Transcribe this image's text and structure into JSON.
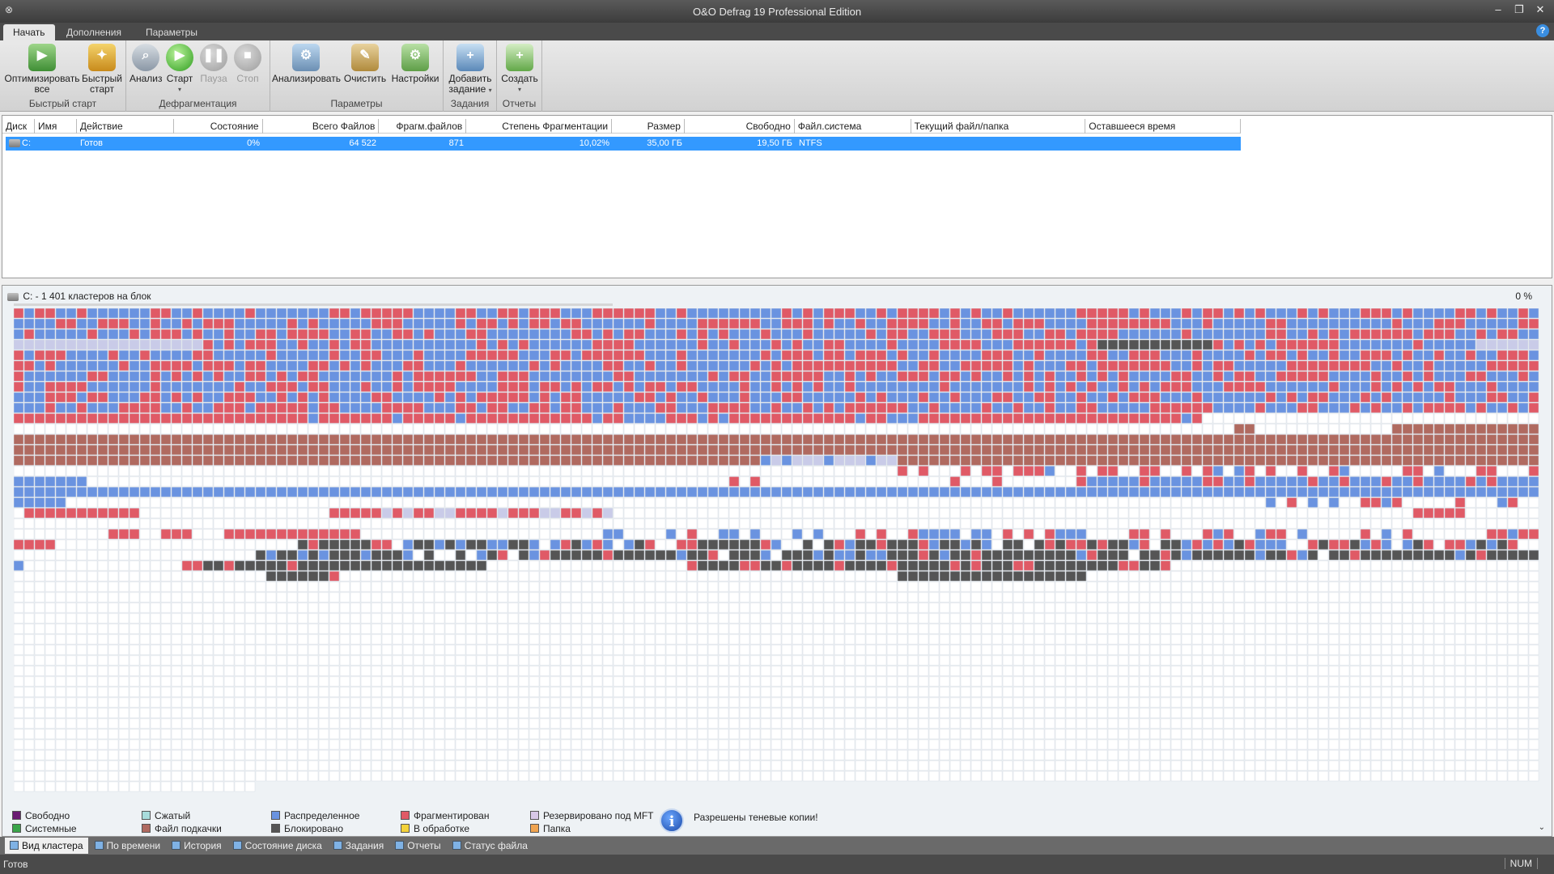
{
  "window": {
    "title": "O&O Defrag 19 Professional Edition",
    "minimize": "–",
    "restore": "❐",
    "close": "✕",
    "sysmenu": "⊗"
  },
  "ribbon_tabs": [
    "Начать",
    "Дополнения",
    "Параметры"
  ],
  "help": "?",
  "ribbon": {
    "groups": [
      {
        "label": "Быстрый старт",
        "buttons": [
          {
            "l1": "Оптимизировать",
            "l2": "все"
          },
          {
            "l1": "Быстрый",
            "l2": "старт"
          }
        ]
      },
      {
        "label": "Дефрагментация",
        "buttons": [
          {
            "l1": "Анализ"
          },
          {
            "l1": "Старт",
            "caret": "▾"
          },
          {
            "l1": "Пауза"
          },
          {
            "l1": "Стоп"
          }
        ]
      },
      {
        "label": "Параметры",
        "buttons": [
          {
            "l1": "Анализировать"
          },
          {
            "l1": "Очистить"
          },
          {
            "l1": "Настройки"
          }
        ]
      },
      {
        "label": "Задания",
        "buttons": [
          {
            "l1": "Добавить",
            "l2": "задание",
            "caret": "▾"
          }
        ]
      },
      {
        "label": "Отчеты",
        "buttons": [
          {
            "l1": "Создать",
            "caret": "▾"
          }
        ]
      }
    ]
  },
  "drives_table": {
    "columns": [
      "Диск",
      "Имя",
      "Действие",
      "Состояние",
      "Всего Файлов",
      "Фрагм.файлов",
      "Степень Фрагментации",
      "Размер",
      "Свободно",
      "Файл.система",
      "Текущий файл/папка",
      "Оставшееся время"
    ],
    "rows": [
      {
        "disk": "C:",
        "name": "",
        "action": "Готов",
        "state": "0%",
        "total_files": "64 522",
        "frag_files": "871",
        "frag_degree": "10,02%",
        "size": "35,00 ГБ",
        "free": "19,50 ГБ",
        "fs": "NTFS",
        "current": "",
        "remaining": ""
      }
    ]
  },
  "cluster_map": {
    "header": "C: - 1 401 кластеров на блок",
    "percent": "0 %",
    "progress": 0,
    "colors": {
      "free": "#ffffff",
      "distributed": "#6a93e0",
      "fragmented": "#e05a66",
      "paging": "#b06a60",
      "blocked": "#555555",
      "mft": "#c9cbe8",
      "processing": "#f3d23a",
      "folder": "#f0a450",
      "compressed": "#a8dcdc",
      "system": "#3aa54a"
    }
  },
  "legend": [
    {
      "label": "Свободно",
      "color": "#6a1a72"
    },
    {
      "label": "Системные",
      "color": "#3aa54a"
    },
    {
      "label": "Сжатый",
      "color": "#a8dcdc"
    },
    {
      "label": "Файл подкачки",
      "color": "#b06a60"
    },
    {
      "label": "Распределенное",
      "color": "#6a93e0"
    },
    {
      "label": "Блокировано",
      "color": "#555555"
    },
    {
      "label": "Фрагментирован",
      "color": "#e05a66"
    },
    {
      "label": "В обработке",
      "color": "#f3d23a"
    },
    {
      "label": "Резервировано под MFT",
      "color": "#d8c8e8"
    },
    {
      "label": "Папка",
      "color": "#f0a450"
    }
  ],
  "info": {
    "icon": "i",
    "text": "Разрешены теневые копии!"
  },
  "view_tabs": [
    "Вид кластера",
    "По времени",
    "История",
    "Состояние диска",
    "Задания",
    "Отчеты",
    "Статус файла"
  ],
  "status": {
    "text": "Готов",
    "num": "NUM"
  },
  "scroll_glyph": "⌄"
}
